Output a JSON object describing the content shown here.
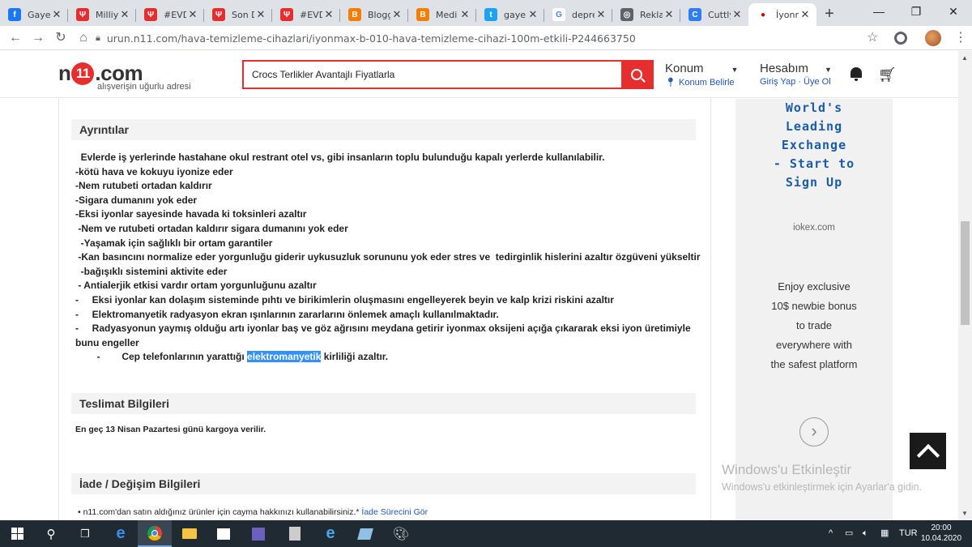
{
  "browser": {
    "tabs": [
      {
        "title": "Gaye",
        "favicon_color": "#1877f2",
        "favicon_glyph": "f",
        "icon": "facebook-icon"
      },
      {
        "title": "Milliy",
        "favicon_color": "#e62e2e",
        "favicon_glyph": "Ψ",
        "icon": "ekşi-icon"
      },
      {
        "title": "#EVD",
        "favicon_color": "#e62e2e",
        "favicon_glyph": "Ψ",
        "icon": "ekşi-icon"
      },
      {
        "title": "Son D",
        "favicon_color": "#e62e2e",
        "favicon_glyph": "Ψ",
        "icon": "ekşi-icon"
      },
      {
        "title": "#EVD",
        "favicon_color": "#e62e2e",
        "favicon_glyph": "Ψ",
        "icon": "ekşi-icon"
      },
      {
        "title": "Blogg",
        "favicon_color": "#f57d00",
        "favicon_glyph": "B",
        "icon": "blogger-icon"
      },
      {
        "title": "Medi",
        "favicon_color": "#f57d00",
        "favicon_glyph": "B",
        "icon": "blogger-icon"
      },
      {
        "title": "gaye",
        "favicon_color": "#1da1f2",
        "favicon_glyph": "t",
        "icon": "twitter-icon"
      },
      {
        "title": "depre",
        "favicon_color": "#ffffff",
        "favicon_glyph": "G",
        "icon": "google-icon"
      },
      {
        "title": "Rekla",
        "favicon_color": "#5f6368",
        "favicon_glyph": "◎",
        "icon": "globe-icon"
      },
      {
        "title": "Cuttly",
        "favicon_color": "#2e7cf6",
        "favicon_glyph": "C",
        "icon": "cuttly-icon"
      },
      {
        "title": "İyonm",
        "favicon_color": "#ffffff",
        "favicon_glyph": "●",
        "icon": "n11-icon",
        "active": true
      }
    ],
    "url": "urun.n11.com/hava-temizleme-cihazlari/iyonmax-b-010-hava-temizleme-cihazi-100m-etkili-P244663750"
  },
  "site": {
    "logo_n": "n",
    "logo_one": "11",
    "logo_rest": ".com",
    "tagline": "alışverişin uğurlu adresi",
    "search_value": "Crocs Terlikler Avantajlı Fiyatlarla",
    "location_label": "Konum",
    "location_sub": "Konum Belirle",
    "account_label": "Hesabım",
    "account_login": "Giriş Yap",
    "account_sep": "·",
    "account_register": "Üye Ol"
  },
  "details": {
    "heading": "Ayrıntılar",
    "lines": [
      "  Evlerde iş yerlerinde hastahane okul restrant otel vs, gibi insanların toplu bulunduğu kapalı yerlerde kullanılabilir.",
      "-kötü hava ve kokuyu iyonize eder",
      "-Nem rutubeti ortadan kaldırır",
      "-Sigara dumanını yok eder",
      "-Eksi iyonlar sayesinde havada ki toksinleri azaltır",
      " -Nem ve rutubeti ortadan kaldırır sigara dumanını yok eder",
      "  -Yaşamak için sağlıklı bir ortam garantiler",
      " -Kan basıncını normalize eder yorgunluğu giderir uykusuzluk sorununu yok eder stres ve  tedirginlik hislerini azaltır özgüveni yükseltir",
      "  -bağışıklı sistemini aktivite eder",
      " - Antialerjik etkisi vardır ortam yorgunluğunu azaltır",
      "-     Eksi iyonlar kan dolaşım sisteminde pıhtı ve birikimlerin oluşmasını engelleyerek beyin ve kalp krizi riskini azaltır",
      "-     Elektromanyetik radyasyon ekran ışınlarının zararlarını önlemek amaçlı kullanılmaktadır.",
      "-     Radyasyonun yaymış olduğu artı iyonlar baş ve göz ağrısını meydana getirir iyonmax oksijeni açığa çıkararak eksi iyon üretimiyle",
      "bunu engeller"
    ],
    "last_line_prefix": "        -        Cep telefonlarının yarattığı ",
    "last_line_highlight": "elektromanyetik",
    "last_line_suffix": " kirliliği azaltır."
  },
  "shipping": {
    "heading": "Teslimat Bilgileri",
    "text": "En geç 13 Nisan Pazartesi günü kargoya verilir."
  },
  "returns": {
    "heading": "İade / Değişim Bilgileri",
    "text": "n11.com'dan satın aldığınız ürünler için cayma hakkınızı kullanabilirsiniz.*",
    "link": "İade Sürecini Gör"
  },
  "ad": {
    "headline": [
      "World's",
      "Leading",
      "Exchange",
      "- Start to",
      "Sign Up"
    ],
    "domain": "iokex.com",
    "body": [
      "Enjoy exclusive",
      "10$ newbie bonus",
      "to trade",
      "everywhere with",
      "the safest platform"
    ],
    "next": "›"
  },
  "watermark": {
    "title": "Windows'u Etkinleştir",
    "subtitle": "Windows'u etkinleştirmek için Ayarlar'a gidin."
  },
  "taskbar": {
    "lang": "TUR",
    "time": "20:00",
    "date": "10.04.2020"
  }
}
